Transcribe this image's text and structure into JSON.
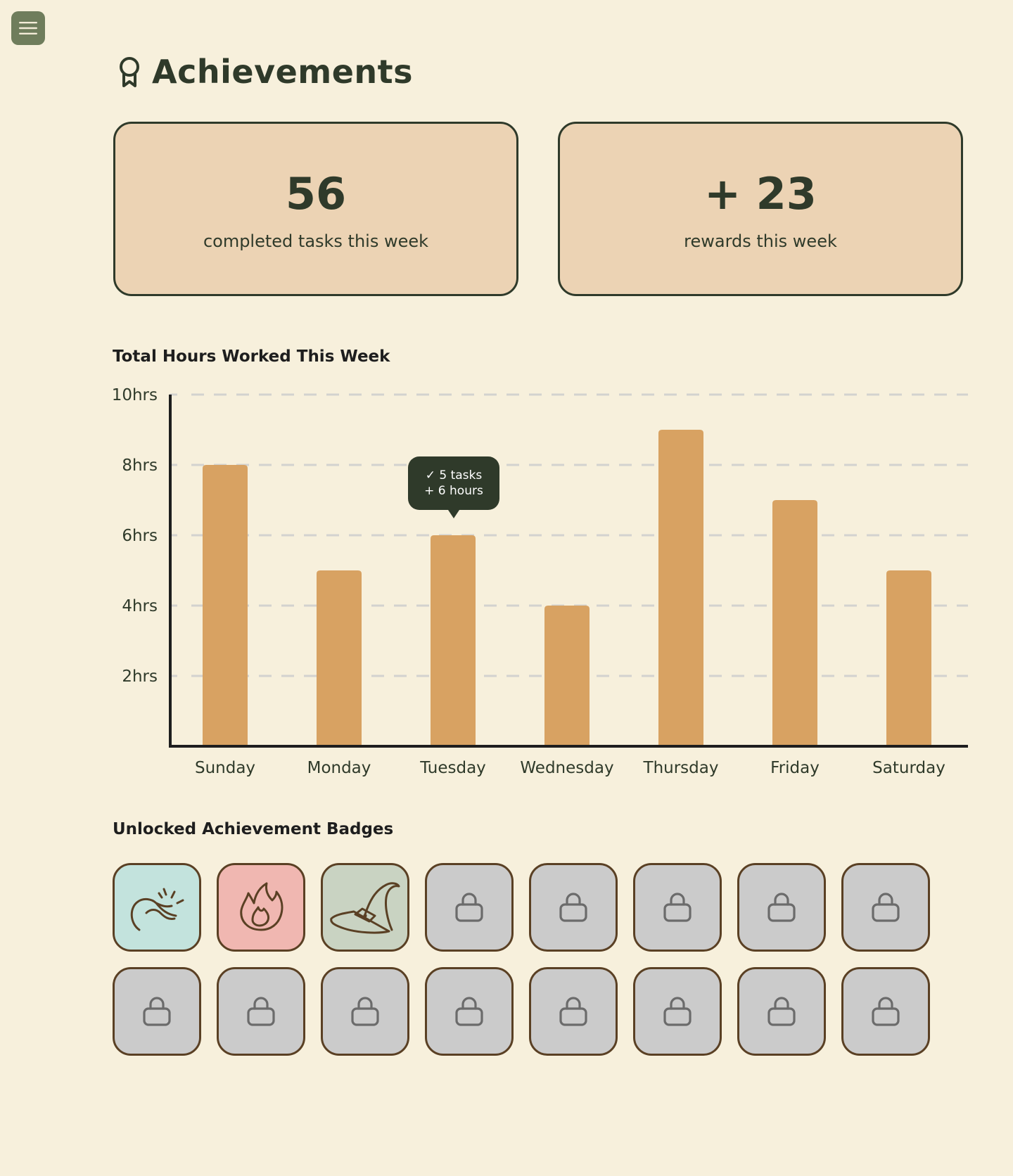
{
  "header": {
    "title": "Achievements",
    "icon": "award-icon"
  },
  "menu": {
    "icon": "hamburger-menu-icon"
  },
  "stats": {
    "completed": {
      "value": "56",
      "label": "completed tasks this week"
    },
    "rewards": {
      "value": "+ 23",
      "label": "rewards this week"
    }
  },
  "chart": {
    "title": "Total Hours Worked This Week",
    "tooltip": {
      "day": "Tuesday",
      "line1": "✓ 5 tasks",
      "line2": "+ 6 hours"
    }
  },
  "chart_data": {
    "type": "bar",
    "title": "Total Hours Worked This Week",
    "xlabel": "",
    "ylabel": "",
    "categories": [
      "Sunday",
      "Monday",
      "Tuesday",
      "Wednesday",
      "Thursday",
      "Friday",
      "Saturday"
    ],
    "values": [
      8,
      5,
      6,
      4,
      9,
      7,
      5
    ],
    "ylim": [
      0,
      10
    ],
    "yticks": [
      2,
      4,
      6,
      8,
      10
    ],
    "ytick_labels": [
      "2hrs",
      "4hrs",
      "6hrs",
      "8hrs",
      "10hrs"
    ],
    "grid": true,
    "bar_color": "#d8a262"
  },
  "badges": {
    "title": "Unlocked Achievement Badges",
    "items": [
      {
        "icon": "sun-hand-icon",
        "unlocked": true,
        "color": "#c3e3dd"
      },
      {
        "icon": "flame-icon",
        "unlocked": true,
        "color": "#f0b7b1"
      },
      {
        "icon": "wizard-hat-icon",
        "unlocked": true,
        "color": "#c9d3c2"
      },
      {
        "icon": "lock-icon",
        "unlocked": false,
        "color": "#cbcbcb"
      },
      {
        "icon": "lock-icon",
        "unlocked": false,
        "color": "#cbcbcb"
      },
      {
        "icon": "lock-icon",
        "unlocked": false,
        "color": "#cbcbcb"
      },
      {
        "icon": "lock-icon",
        "unlocked": false,
        "color": "#cbcbcb"
      },
      {
        "icon": "lock-icon",
        "unlocked": false,
        "color": "#cbcbcb"
      },
      {
        "icon": "lock-icon",
        "unlocked": false,
        "color": "#cbcbcb"
      },
      {
        "icon": "lock-icon",
        "unlocked": false,
        "color": "#cbcbcb"
      },
      {
        "icon": "lock-icon",
        "unlocked": false,
        "color": "#cbcbcb"
      },
      {
        "icon": "lock-icon",
        "unlocked": false,
        "color": "#cbcbcb"
      },
      {
        "icon": "lock-icon",
        "unlocked": false,
        "color": "#cbcbcb"
      },
      {
        "icon": "lock-icon",
        "unlocked": false,
        "color": "#cbcbcb"
      },
      {
        "icon": "lock-icon",
        "unlocked": false,
        "color": "#cbcbcb"
      },
      {
        "icon": "lock-icon",
        "unlocked": false,
        "color": "#cbcbcb"
      }
    ]
  },
  "colors": {
    "background": "#f7f0dc",
    "card": "#ecd3b4",
    "ink": "#2f3a2a",
    "menu": "#6f7d5c"
  }
}
